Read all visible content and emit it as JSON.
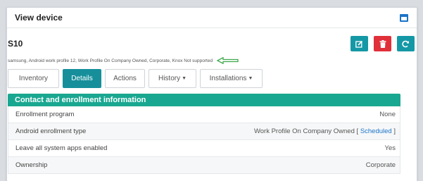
{
  "panel": {
    "title": "View device"
  },
  "device": {
    "name": "S10",
    "description": "samsung, Android work profile 12, Work Profile On Company Owned, Corporate, Knox Not supported"
  },
  "actions": [
    {
      "icon": "edit-icon",
      "color": "#1598a6"
    },
    {
      "icon": "trash-icon",
      "color": "#e0303a"
    },
    {
      "icon": "refresh-icon",
      "color": "#1598a6"
    }
  ],
  "tabs": [
    {
      "label": "Inventory",
      "active": false
    },
    {
      "label": "Details",
      "active": true
    },
    {
      "label": "Actions",
      "active": false
    },
    {
      "label": "History",
      "active": false,
      "dropdown": true
    },
    {
      "label": "Installations",
      "active": false,
      "dropdown": true
    }
  ],
  "section": {
    "header": "Contact and enrollment information",
    "rows": [
      {
        "label": "Enrollment program",
        "value": "None"
      },
      {
        "label": "Android enrollment type",
        "value": "Work Profile On Company Owned",
        "bracket_open": "[",
        "link": "Scheduled",
        "bracket_close": "]"
      },
      {
        "label": "Leave all system apps enabled",
        "value": "Yes"
      },
      {
        "label": "Ownership",
        "value": "Corporate"
      }
    ]
  },
  "colors": {
    "accent": "#168f9b",
    "header": "#1aa791",
    "danger": "#e0303a",
    "arrow": "#3ea84b"
  }
}
